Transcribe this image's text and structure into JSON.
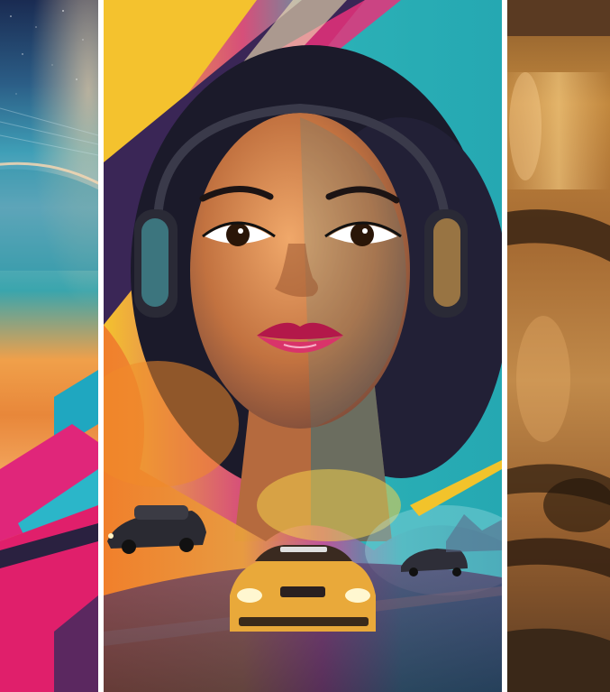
{
  "image": {
    "panels": [
      {
        "name": "left-panel",
        "subject": "space-horizon-geometric-art"
      },
      {
        "name": "center-panel",
        "subject": "retro-poster-woman-headphones-cars"
      },
      {
        "name": "right-panel",
        "subject": "golden-helmet-closeup"
      }
    ],
    "colors": {
      "divider": "#ffffff",
      "teal": "#1fa7b0",
      "magenta": "#e0267a",
      "orange": "#f08a2a",
      "yellow": "#f2c32b",
      "gold": "#b8782e",
      "deep_navy": "#1b1f3a"
    }
  }
}
